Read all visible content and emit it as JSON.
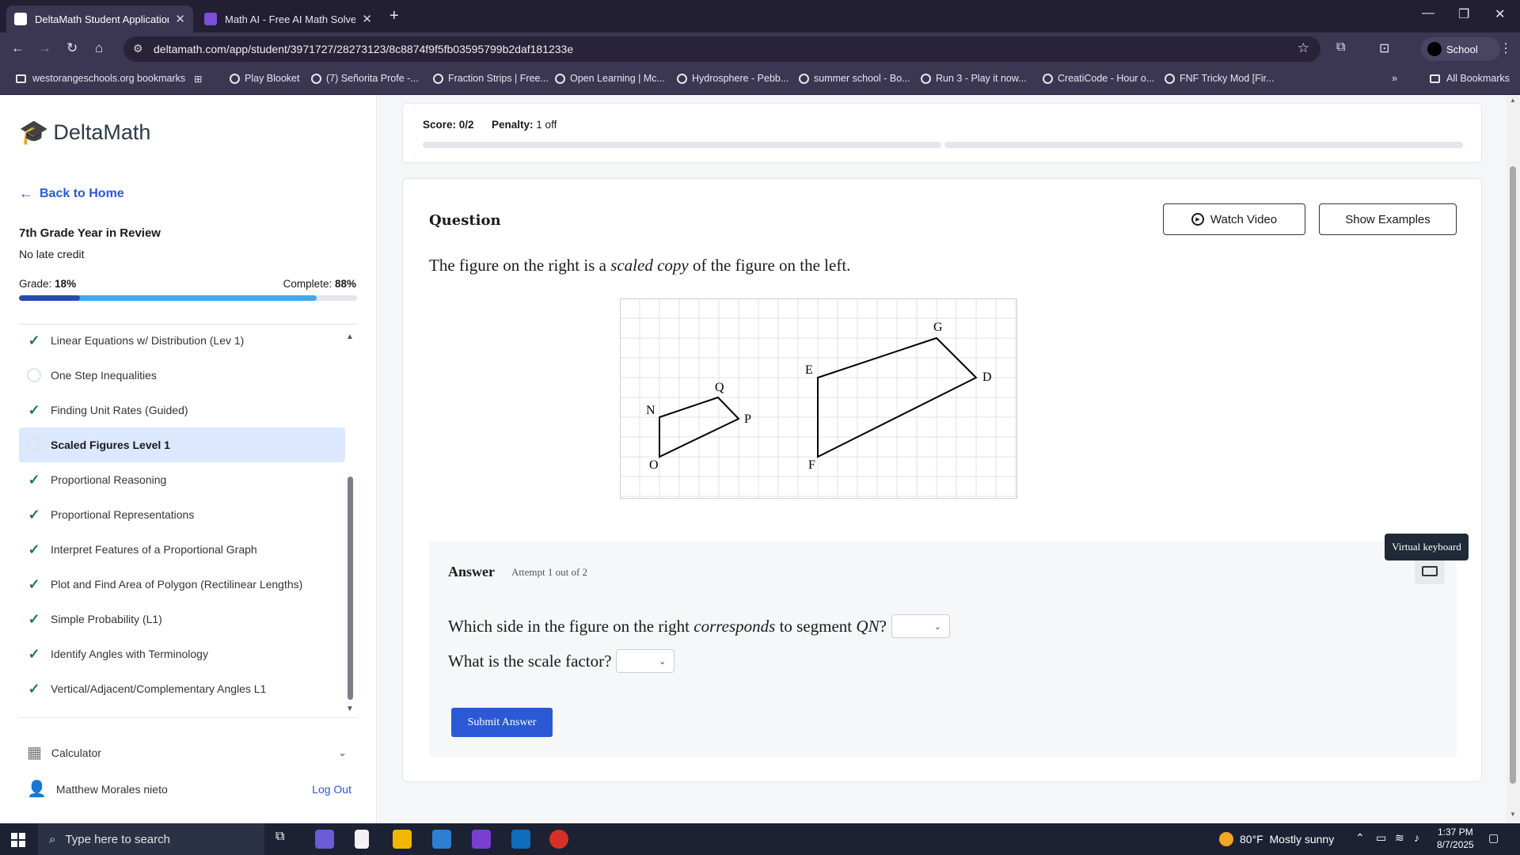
{
  "browser": {
    "tabs": [
      {
        "title": "DeltaMath Student Application",
        "favicon_color": "#ffffff"
      },
      {
        "title": "Math AI - Free AI Math Solver &",
        "favicon_color": "#7b4fd8"
      }
    ],
    "url": "deltamath.com/app/student/3971727/28273123/8c8874f9f5fb03595799b2daf181233e",
    "profile_label": "School",
    "bookmarks": [
      "westorangeschools.org bookmarks",
      "Play Blooket",
      "(7) Señorita Profe -...",
      "Fraction Strips | Free...",
      "Open Learning | Mc...",
      "Hydrosphere - Pebb...",
      "summer school - Bo...",
      "Run 3 - Play it now...",
      "CreatiCode - Hour o...",
      "FNF Tricky Mod [Fir..."
    ],
    "all_bookmarks": "All Bookmarks"
  },
  "sidebar": {
    "logo_text": "DeltaMath",
    "back_label": "Back to Home",
    "course_title": "7th Grade Year in Review",
    "late_credit": "No late credit",
    "grade_label": "Grade:",
    "grade_value": "18%",
    "complete_label": "Complete:",
    "complete_value": "88%",
    "grade_fraction": 0.18,
    "complete_fraction": 0.88,
    "assignments": [
      {
        "label": "Linear Equations w/ Distribution (Lev 1)",
        "done": true
      },
      {
        "label": "One Step Inequalities",
        "done": false
      },
      {
        "label": "Finding Unit Rates (Guided)",
        "done": true
      },
      {
        "label": "Scaled Figures Level 1",
        "done": false,
        "active": true
      },
      {
        "label": "Proportional Reasoning",
        "done": true
      },
      {
        "label": "Proportional Representations",
        "done": true
      },
      {
        "label": "Interpret Features of a Proportional Graph",
        "done": true
      },
      {
        "label": "Plot and Find Area of Polygon (Rectilinear Lengths)",
        "done": true
      },
      {
        "label": "Simple Probability (L1)",
        "done": true
      },
      {
        "label": "Identify Angles with Terminology",
        "done": true
      },
      {
        "label": "Vertical/Adjacent/Complementary Angles L1",
        "done": true
      }
    ],
    "calculator_label": "Calculator",
    "user_name": "Matthew Morales nieto",
    "logout_label": "Log Out"
  },
  "scorebar": {
    "score_label": "Score:",
    "score_value": "0/2",
    "penalty_label": "Penalty:",
    "penalty_value": "1 off"
  },
  "question": {
    "heading": "Question",
    "watch_video": "Watch Video",
    "show_examples": "Show Examples",
    "prompt_pre": "The figure on the right is a ",
    "prompt_em": "scaled copy",
    "prompt_post": " of the figure on the left.",
    "figure_labels": {
      "Q": "Q",
      "N": "N",
      "P": "P",
      "O": "O",
      "G": "G",
      "E": "E",
      "D": "D",
      "F": "F"
    }
  },
  "answer": {
    "label": "Answer",
    "attempt": "Attempt 1 out of 2",
    "tooltip": "Virtual keyboard",
    "q1_pre": "Which side in the figure on the right ",
    "q1_em": "corresponds",
    "q1_mid": " to segment ",
    "q1_math": "QN",
    "q1_post": "?",
    "q2": "What is the scale factor?",
    "submit": "Submit Answer"
  },
  "taskbar": {
    "search_placeholder": "Type here to search",
    "weather_temp": "80°F",
    "weather_desc": "Mostly sunny",
    "time": "1:37 PM",
    "date": "8/7/2025"
  }
}
